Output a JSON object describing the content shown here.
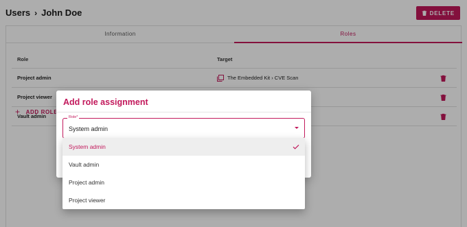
{
  "breadcrumb": {
    "parent": "Users",
    "separator": "›",
    "current": "John Doe"
  },
  "header": {
    "delete_label": "DELETE"
  },
  "tabs": [
    {
      "label": "Information",
      "active": false
    },
    {
      "label": "Roles",
      "active": true
    }
  ],
  "table": {
    "headers": {
      "role": "Role",
      "target": "Target"
    },
    "rows": [
      {
        "role": "Project admin",
        "target": "The Embedded Kit › CVE Scan"
      },
      {
        "role": "Project viewer",
        "target": ""
      },
      {
        "role": "Vault admin",
        "target": ""
      }
    ],
    "add_role_label": "ADD ROLE"
  },
  "dialog": {
    "title": "Add role assignment",
    "field_label": "Role*",
    "field_value": "System admin",
    "options": [
      {
        "label": "System admin",
        "selected": true
      },
      {
        "label": "Vault admin",
        "selected": false
      },
      {
        "label": "Project admin",
        "selected": false
      },
      {
        "label": "Project viewer",
        "selected": false
      }
    ]
  },
  "colors": {
    "accent": "#c2185b",
    "scrim": "rgba(0,0,0,0.32)"
  }
}
